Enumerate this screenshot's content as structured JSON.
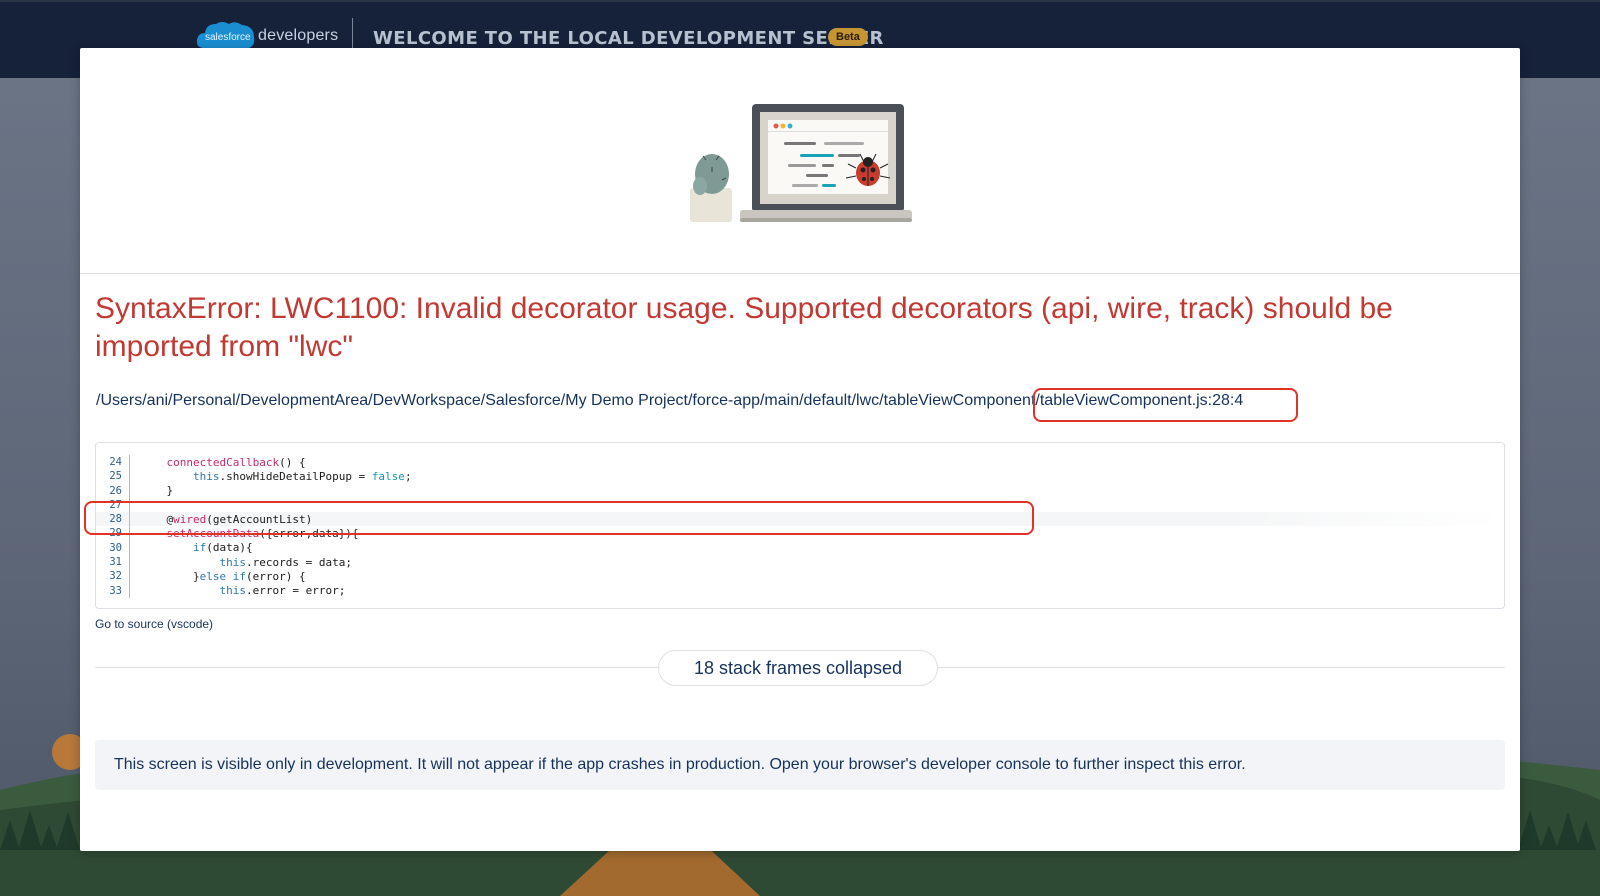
{
  "header": {
    "logo_cloud_text": "salesforce",
    "logo_text": "developers",
    "title": "WELCOME TO THE LOCAL DEVELOPMENT SERVER",
    "badge": "Beta"
  },
  "error": {
    "title": "SyntaxError: LWC1100: Invalid decorator usage. Supported decorators (api, wire, track) should be imported from \"lwc\"",
    "file_path": "/Users/ani/Personal/DevelopmentArea/DevWorkspace/Salesforce/My Demo Project/force-app/main/default/lwc/tableViewComponent/tableViewComponent.js:28:4"
  },
  "code": {
    "lines": [
      {
        "num": "24",
        "indent": "    ",
        "parts": [
          [
            "pink",
            "connectedCallback"
          ],
          [
            "plain",
            "() {"
          ]
        ]
      },
      {
        "num": "25",
        "indent": "        ",
        "parts": [
          [
            "blue",
            "this"
          ],
          [
            "plain",
            ".showHideDetailPopup = "
          ],
          [
            "teal",
            "false"
          ],
          [
            "plain",
            ";"
          ]
        ]
      },
      {
        "num": "26",
        "indent": "    ",
        "parts": [
          [
            "plain",
            "}"
          ]
        ]
      },
      {
        "num": "27",
        "indent": "",
        "parts": []
      },
      {
        "num": "28",
        "indent": "    ",
        "parts": [
          [
            "plain",
            "@"
          ],
          [
            "pink",
            "wired"
          ],
          [
            "plain",
            "(getAccountList)"
          ]
        ]
      },
      {
        "num": "29",
        "indent": "    ",
        "parts": [
          [
            "pink",
            "setAccountData"
          ],
          [
            "plain",
            "({error,data}){"
          ]
        ]
      },
      {
        "num": "30",
        "indent": "        ",
        "parts": [
          [
            "blue",
            "if"
          ],
          [
            "plain",
            "(data){"
          ]
        ]
      },
      {
        "num": "31",
        "indent": "            ",
        "parts": [
          [
            "blue",
            "this"
          ],
          [
            "plain",
            ".records = data;"
          ]
        ]
      },
      {
        "num": "32",
        "indent": "        ",
        "parts": [
          [
            "plain",
            "}"
          ],
          [
            "blue",
            "else if"
          ],
          [
            "plain",
            "(error) {"
          ]
        ]
      },
      {
        "num": "33",
        "indent": "            ",
        "parts": [
          [
            "blue",
            "this"
          ],
          [
            "plain",
            ".error = error;"
          ]
        ]
      }
    ],
    "highlighted_line": "28"
  },
  "go_to_source_label": "Go to source (vscode)",
  "stack_frames_label": "18 stack frames collapsed",
  "notice": "This screen is visible only in development. It will not appear if the app crashes in production. Open your browser's developer console to further inspect this error.",
  "colors": {
    "error_red": "#c23934",
    "annotation_red": "#e03326",
    "text_navy": "#16325c",
    "header_bg": "#16213a",
    "badge_gold": "#c59533"
  }
}
